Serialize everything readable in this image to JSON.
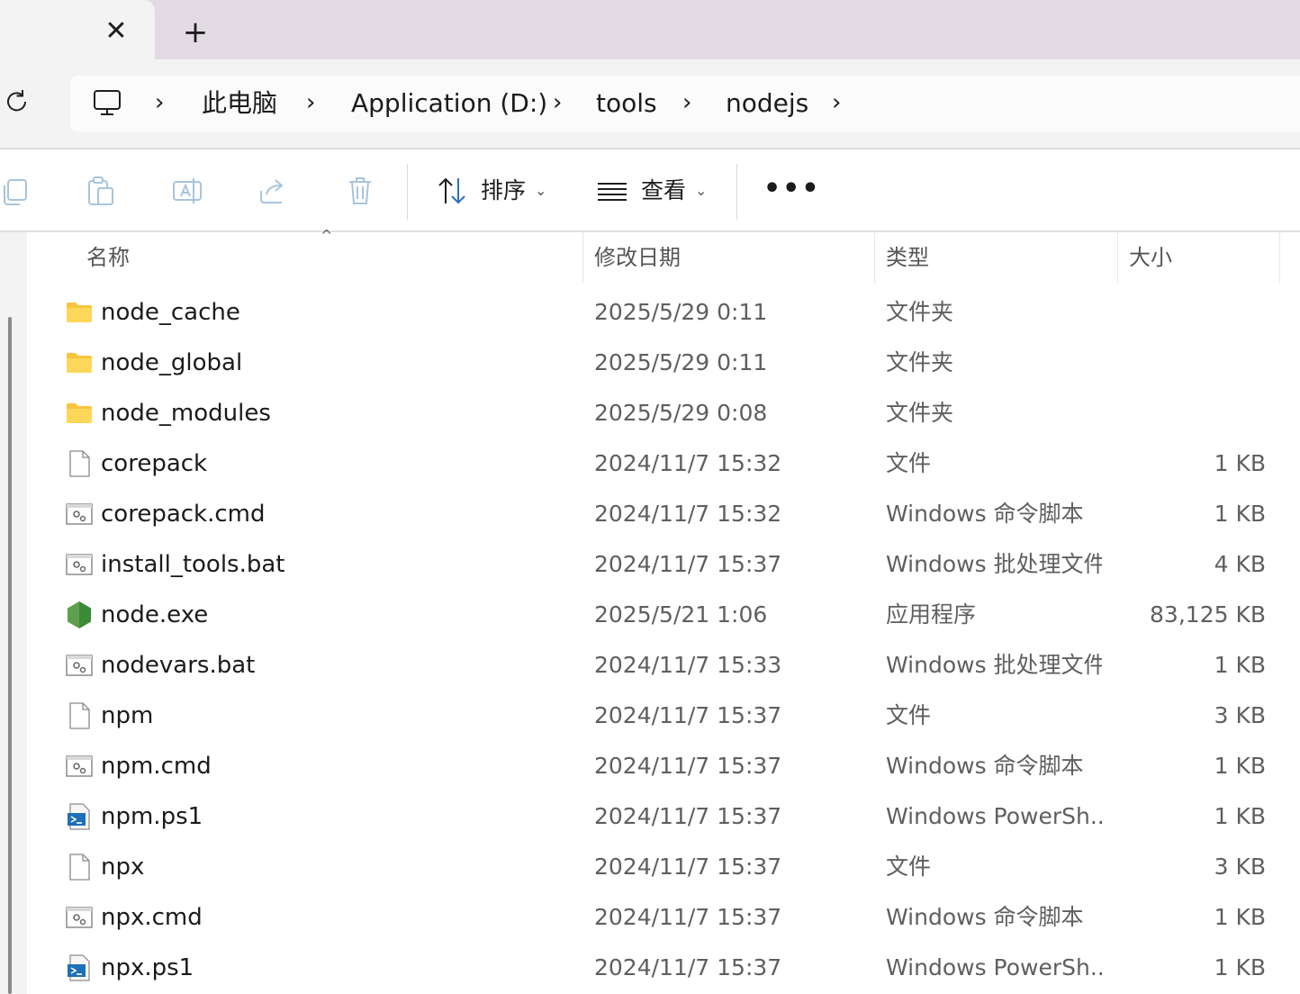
{
  "tabbar": {
    "close_glyph": "✕",
    "new_tab_glyph": "+"
  },
  "address": {
    "separator": "›",
    "crumbs": [
      "此电脑",
      "Application (D:)",
      "tools",
      "nodejs"
    ]
  },
  "toolbar": {
    "sort_label": "排序",
    "view_label": "查看",
    "more_label": "•••",
    "dropdown_glyph": "⌄"
  },
  "columns": {
    "name": "名称",
    "date": "修改日期",
    "type": "类型",
    "size": "大小",
    "sort_indicator": "^"
  },
  "files": [
    {
      "name": "node_cache",
      "date": "2025/5/29 0:11",
      "type": "文件夹",
      "size": "",
      "icon": "folder-icon"
    },
    {
      "name": "node_global",
      "date": "2025/5/29 0:11",
      "type": "文件夹",
      "size": "",
      "icon": "folder-icon"
    },
    {
      "name": "node_modules",
      "date": "2025/5/29 0:08",
      "type": "文件夹",
      "size": "",
      "icon": "folder-icon"
    },
    {
      "name": "corepack",
      "date": "2024/11/7 15:32",
      "type": "文件",
      "size": "1 KB",
      "icon": "file-icon"
    },
    {
      "name": "corepack.cmd",
      "date": "2024/11/7 15:32",
      "type": "Windows 命令脚本",
      "size": "1 KB",
      "icon": "script-icon"
    },
    {
      "name": "install_tools.bat",
      "date": "2024/11/7 15:37",
      "type": "Windows 批处理文件",
      "size": "4 KB",
      "icon": "script-icon"
    },
    {
      "name": "node.exe",
      "date": "2025/5/21 1:06",
      "type": "应用程序",
      "size": "83,125 KB",
      "icon": "nodejs-icon"
    },
    {
      "name": "nodevars.bat",
      "date": "2024/11/7 15:33",
      "type": "Windows 批处理文件",
      "size": "1 KB",
      "icon": "script-icon"
    },
    {
      "name": "npm",
      "date": "2024/11/7 15:37",
      "type": "文件",
      "size": "3 KB",
      "icon": "file-icon"
    },
    {
      "name": "npm.cmd",
      "date": "2024/11/7 15:37",
      "type": "Windows 命令脚本",
      "size": "1 KB",
      "icon": "script-icon"
    },
    {
      "name": "npm.ps1",
      "date": "2024/11/7 15:37",
      "type": "Windows PowerSh...",
      "size": "1 KB",
      "icon": "powershell-icon"
    },
    {
      "name": "npx",
      "date": "2024/11/7 15:37",
      "type": "文件",
      "size": "3 KB",
      "icon": "file-icon"
    },
    {
      "name": "npx.cmd",
      "date": "2024/11/7 15:37",
      "type": "Windows 命令脚本",
      "size": "1 KB",
      "icon": "script-icon"
    },
    {
      "name": "npx.ps1",
      "date": "2024/11/7 15:37",
      "type": "Windows PowerSh...",
      "size": "1 KB",
      "icon": "powershell-icon"
    }
  ]
}
